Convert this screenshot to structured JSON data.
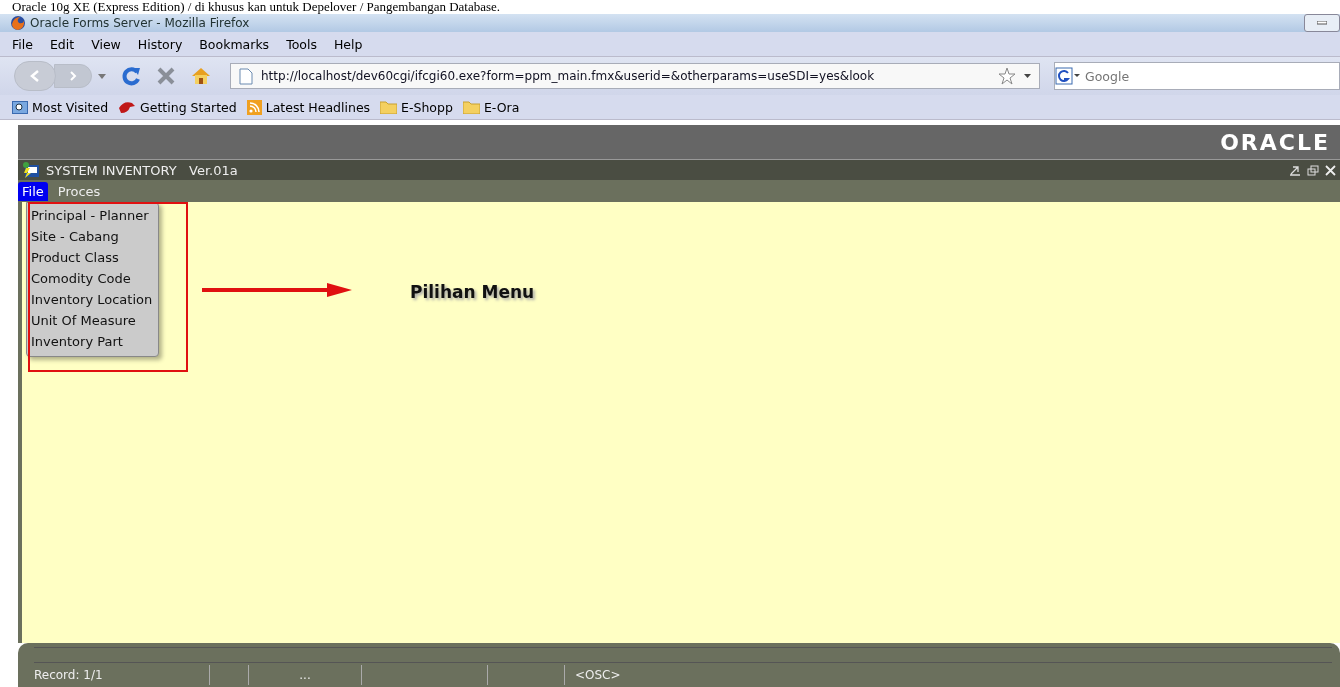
{
  "caption": "Oracle 10g XE (Express Edition) / di khusus kan untuk Depelover / Pangembangan Database.",
  "browser": {
    "title": "Oracle Forms Server - Mozilla Firefox",
    "menu": [
      "File",
      "Edit",
      "View",
      "History",
      "Bookmarks",
      "Tools",
      "Help"
    ],
    "url": "http://localhost/dev60cgi/ifcgi60.exe?form=ppm_main.fmx&userid=&otherparams=useSDI=yes&look",
    "search": {
      "placeholder": "Google"
    },
    "bookmarks": [
      "Most Visited",
      "Getting Started",
      "Latest Headlines",
      "E-Shopp",
      "E-Ora"
    ]
  },
  "banner": {
    "logo": "ORACLE"
  },
  "form": {
    "title": "SYSTEM INVENTORY   Ver.01a",
    "menu": [
      {
        "label": "File",
        "selected": true
      },
      {
        "label": "Proces",
        "selected": false
      }
    ],
    "dropdown": [
      "Principal - Planner",
      "Site - Cabang",
      "Product Class",
      "Comodity Code",
      "Inventory Location",
      "Unit Of Measure",
      "Inventory Part"
    ],
    "annotation": "Pilihan Menu",
    "status": [
      "Record: 1/1",
      "...",
      "<OSC>"
    ]
  }
}
